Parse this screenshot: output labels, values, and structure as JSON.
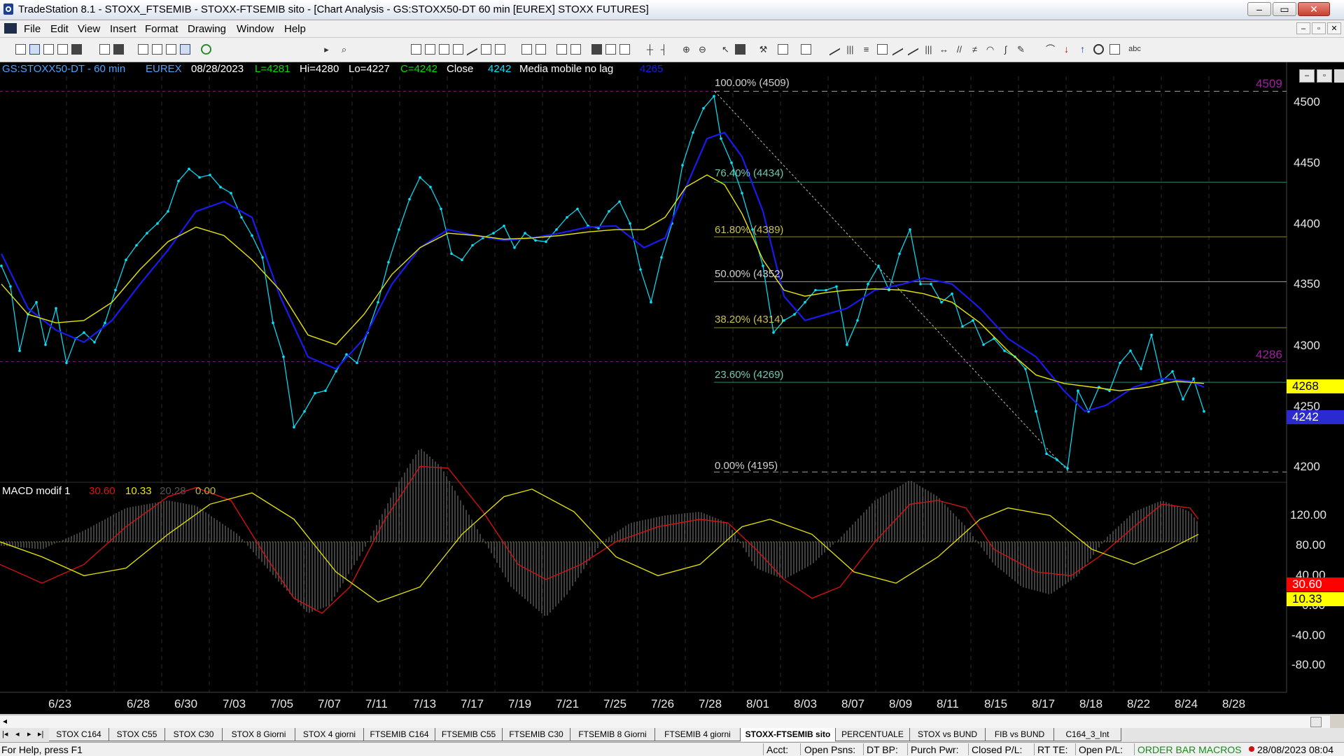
{
  "window": {
    "title": "TradeStation 8.1 - STOXX_FTSEMIB - STOXX-FTSEMIB sito - [Chart Analysis - GS:STOXX50-DT  60 min  [EUREX] STOXX FUTURES]",
    "controls": [
      "–",
      "▭",
      "✕"
    ]
  },
  "menu": {
    "items": [
      "File",
      "Edit",
      "View",
      "Insert",
      "Format",
      "Drawing",
      "Window",
      "Help"
    ],
    "mdi_controls": [
      "–",
      "▫",
      "✕"
    ]
  },
  "colors": {
    "chart_bg": "#000000",
    "price": "#00e5ff",
    "ma_blue": "#1a1aee",
    "ma_yellow": "#e6e600",
    "macd_red": "#e01010",
    "macd_yellow": "#e6e600",
    "fib_teal": "#6fc9b0",
    "fib_olive": "#b8b24a"
  },
  "chart": {
    "header": {
      "symbol": "GS:STOXX50-DT - 60 min",
      "exchange": "EUREX",
      "date": "08/28/2023",
      "last": "L=4281",
      "high": "Hi=4280",
      "low": "Lo=4227",
      "close": "C=4242",
      "close_label": "Close",
      "close_value": "4242",
      "indicator": "Media mobile no lag",
      "indicator_value": "4265"
    },
    "fib_levels": [
      "100.00% (4509)",
      "76.40% (4434)",
      "61.80% (4389)",
      "50.00% (4352)",
      "38.20% (4314)",
      "23.60% (4269)",
      "0.00% (4195)"
    ],
    "price_labels": {
      "top": "4509",
      "mid": "4286",
      "yellow": "4268",
      "blue": "4242"
    },
    "y_axis": [
      "4500",
      "4450",
      "4400",
      "4350",
      "4300",
      "4250",
      "4200"
    ],
    "macd": {
      "label": "MACD modif 1",
      "v1": "30.60",
      "v2": "10.33",
      "v3": "20.28",
      "v4": "0.00",
      "y_axis": [
        "120.00",
        "80.00",
        "40.00",
        "0.00",
        "-40.00",
        "-80.00"
      ],
      "box_red": "30.60",
      "box_yellow": "10.33"
    },
    "x_axis": [
      "6/23",
      "6/28",
      "6/30",
      "7/03",
      "7/05",
      "7/07",
      "7/11",
      "7/13",
      "7/17",
      "7/19",
      "7/21",
      "7/25",
      "7/26",
      "7/28",
      "8/01",
      "8/03",
      "8/07",
      "8/09",
      "8/11",
      "8/15",
      "8/17",
      "8/18",
      "8/22",
      "8/24",
      "8/28"
    ]
  },
  "tabs": {
    "nav": [
      "|◂",
      "◂",
      "▸",
      "▸|"
    ],
    "items": [
      "STOX C164",
      "STOX C55",
      "STOX  C30",
      "STOX  8 Giorni",
      "STOX 4 giorni",
      "FTSEMIB C164",
      "FTSEMIB C55",
      "FTSEMIB C30",
      "FTSEMIB  8 Giorni",
      "FTSEMIB  4 giorni",
      "STOXX-FTSEMIB sito",
      "PERCENTUALE",
      "STOX vs BUND",
      "FIB vs BUND",
      "C164_3_Int"
    ],
    "active": "STOXX-FTSEMIB sito"
  },
  "status": {
    "help": "For Help, press F1",
    "acct": "Acct:",
    "open_psns": "Open Psns:",
    "dt_bp": "DT BP:",
    "purch_pwr": "Purch Pwr:",
    "closed_pl": "Closed P/L:",
    "rt_te": "RT TE:",
    "open_pl": "Open P/L:",
    "macros": "ORDER BAR  MACROS",
    "datetime": "28/08/2023 08:04"
  }
}
